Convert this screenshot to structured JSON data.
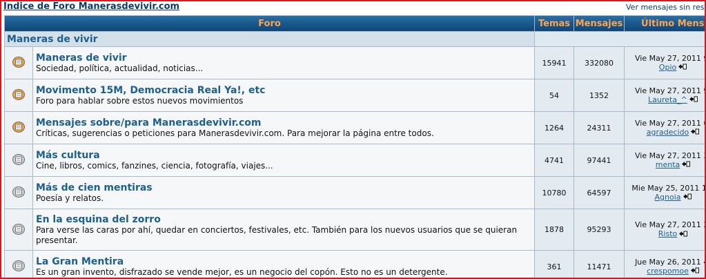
{
  "top": {
    "index_link": "Índice de Foro Manerasdevivir.com",
    "view_link": "Ver mensajes sin respuesta"
  },
  "headers": {
    "forum": "Foro",
    "topics": "Temas",
    "posts": "Mensajes",
    "last_post": "Último Mensaje"
  },
  "category": "Maneras de vivir",
  "forums": [
    {
      "name": "Maneras de vivir",
      "desc": "Sociedad, política, actualidad, noticias...",
      "topics": "15941",
      "posts": "332080",
      "date": "Vie May 27, 2011 9:",
      "user": "Opio",
      "icon": "folder-new-icon"
    },
    {
      "name": "Movimento 15M, Democracia Real Ya!, etc",
      "desc": "Foro para hablar sobre estos nuevos movimientos",
      "topics": "54",
      "posts": "1352",
      "date": "Vie May 27, 2011 9:",
      "user": "Laureta_^",
      "icon": "folder-new-icon"
    },
    {
      "name": "Mensajes sobre/para Manerasdevivir.com",
      "desc": "Críticas, sugerencias o peticiones para Manerasdevivir.com. Para mejorar la página entre todos.",
      "topics": "1264",
      "posts": "24311",
      "date": "Vie May 27, 2011 6:",
      "user": "agradecido",
      "icon": "folder-new-icon"
    },
    {
      "name": "Más cultura",
      "desc": "Cine, libros, comics, fanzines, ciencia, fotografía, viajes...",
      "topics": "4741",
      "posts": "97441",
      "date": "Vie May 27, 2011 3:",
      "user": "menta",
      "icon": "folder-icon"
    },
    {
      "name": "Más de cien mentiras",
      "desc": "Poesía y relatos.",
      "topics": "10780",
      "posts": "64597",
      "date": "Mie May 25, 2011 10:",
      "user": "Agnoia",
      "icon": "folder-icon"
    },
    {
      "name": "En la esquina del zorro",
      "desc": "Para verse las caras por ahí, quedar en conciertos, festivales, etc. También para los nuevos usuarios que se quieran presentar.",
      "topics": "1878",
      "posts": "95293",
      "date": "Vie May 27, 2011 2:",
      "user": "Risto",
      "icon": "folder-icon"
    },
    {
      "name": "La Gran Mentira",
      "desc": "Es un gran invento, disfrazado se vende mejor, es un negocio del copón. Esto no es un detergente.",
      "topics": "361",
      "posts": "11471",
      "date": "Jue May 26, 2011 4:",
      "user": "crespomoe",
      "icon": "folder-icon"
    }
  ],
  "colors": {
    "header_text": "#ffa34f",
    "header_bg": "#1b5a8f",
    "forum_link": "#1d5f91",
    "new_folder": "#f2a43b",
    "old_folder": "#c8d0d8",
    "frame_border": "#e0141c"
  }
}
